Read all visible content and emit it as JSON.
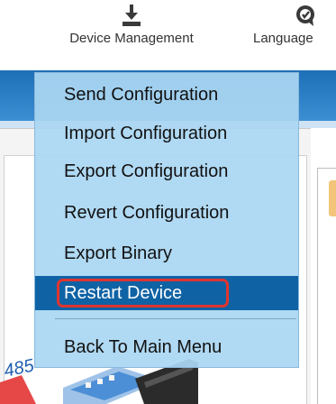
{
  "toolbar": {
    "device_management": {
      "label": "Device Management",
      "icon": "download-tray-icon"
    },
    "language": {
      "label": "Language",
      "icon": "globe-icon"
    }
  },
  "menu": {
    "items": [
      {
        "label": "Send Configuration",
        "selected": false
      },
      {
        "label": "Import Configuration",
        "selected": false
      },
      {
        "label": "Export Configuration",
        "selected": false
      },
      {
        "label": "Revert Configuration",
        "selected": false
      },
      {
        "label": "Export Binary",
        "selected": false
      },
      {
        "label": "Restart Device",
        "selected": true
      },
      {
        "label": "Back To Main Menu",
        "selected": false
      }
    ]
  },
  "colors": {
    "menu_background": "#aad6f2",
    "selected_background": "#0f63a5",
    "highlight_ring": "#e0342f",
    "header_band": "#1d6fb6"
  },
  "device_image": {
    "icon": "rs485-device-icon",
    "label": "485"
  }
}
